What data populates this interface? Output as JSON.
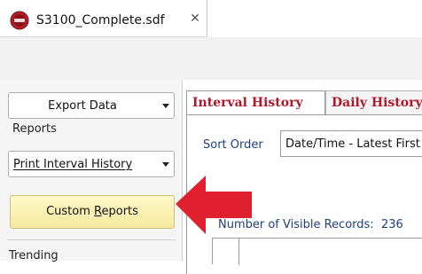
{
  "document_tab": {
    "title": "S3100_Complete.sdf",
    "close_glyph": "✕",
    "icon": "app-logo-icon"
  },
  "sidebar": {
    "export_data": "Export Data",
    "reports_label": "Reports",
    "print_select_value": "Print Interval History",
    "custom_reports_prefix": "Custom ",
    "custom_reports_mnemonic": "R",
    "custom_reports_suffix": "eports",
    "trending_label": "Trending"
  },
  "main": {
    "tabs": [
      {
        "label": "Interval History"
      },
      {
        "label": "Daily History"
      }
    ],
    "sort_order_label": "Sort Order",
    "sort_order_value": "Date/Time - Latest First",
    "visible_records_label": "Number of Visible Records:",
    "visible_records_count": "236"
  },
  "colors": {
    "tab_text": "#b0172b",
    "label_text": "#1f3e7a",
    "button_yellow": "#fff8c8",
    "callout_red": "#e0202f"
  }
}
